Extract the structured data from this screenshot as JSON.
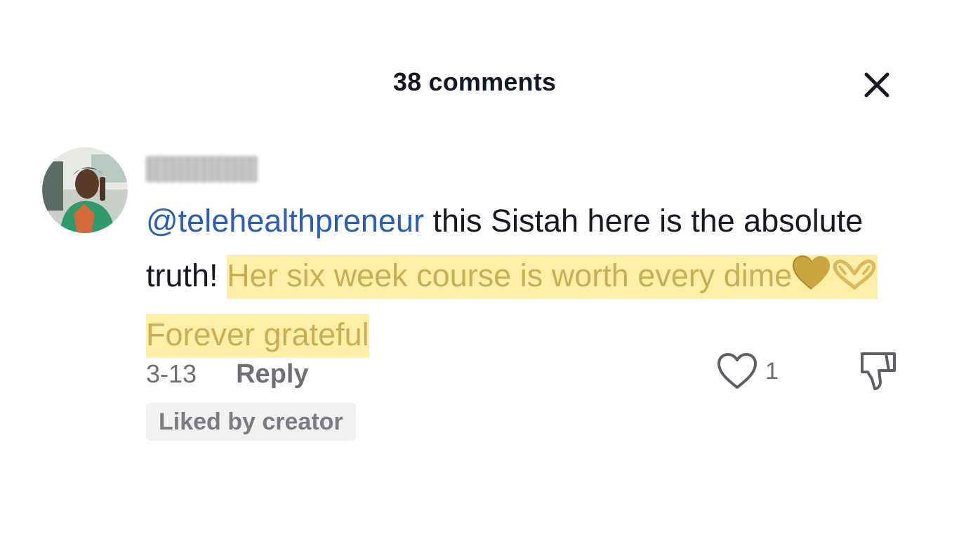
{
  "header": {
    "title": "38 comments",
    "close_icon": "close-icon"
  },
  "comment": {
    "avatar": "avatar-photo",
    "username_redacted": true,
    "mention": "@telehealthpreneur",
    "text_before": " this Sistah here is the absolute truth! ",
    "highlighted_part1": "Her six week course is worth every dime",
    "emoji_heart": "gold-heart-icon",
    "emoji_hands": "heart-hands-icon",
    "highlighted_part2": "Forever grateful",
    "highlight_color": "#fdf0a6",
    "highlight_text_color": "#c9ae55",
    "mention_color": "#2b5db0",
    "date": "3-13",
    "reply_label": "Reply",
    "like_icon": "heart-outline-icon",
    "like_count": "1",
    "dislike_icon": "thumbs-down-icon",
    "liked_by_creator_label": "Liked by creator"
  }
}
